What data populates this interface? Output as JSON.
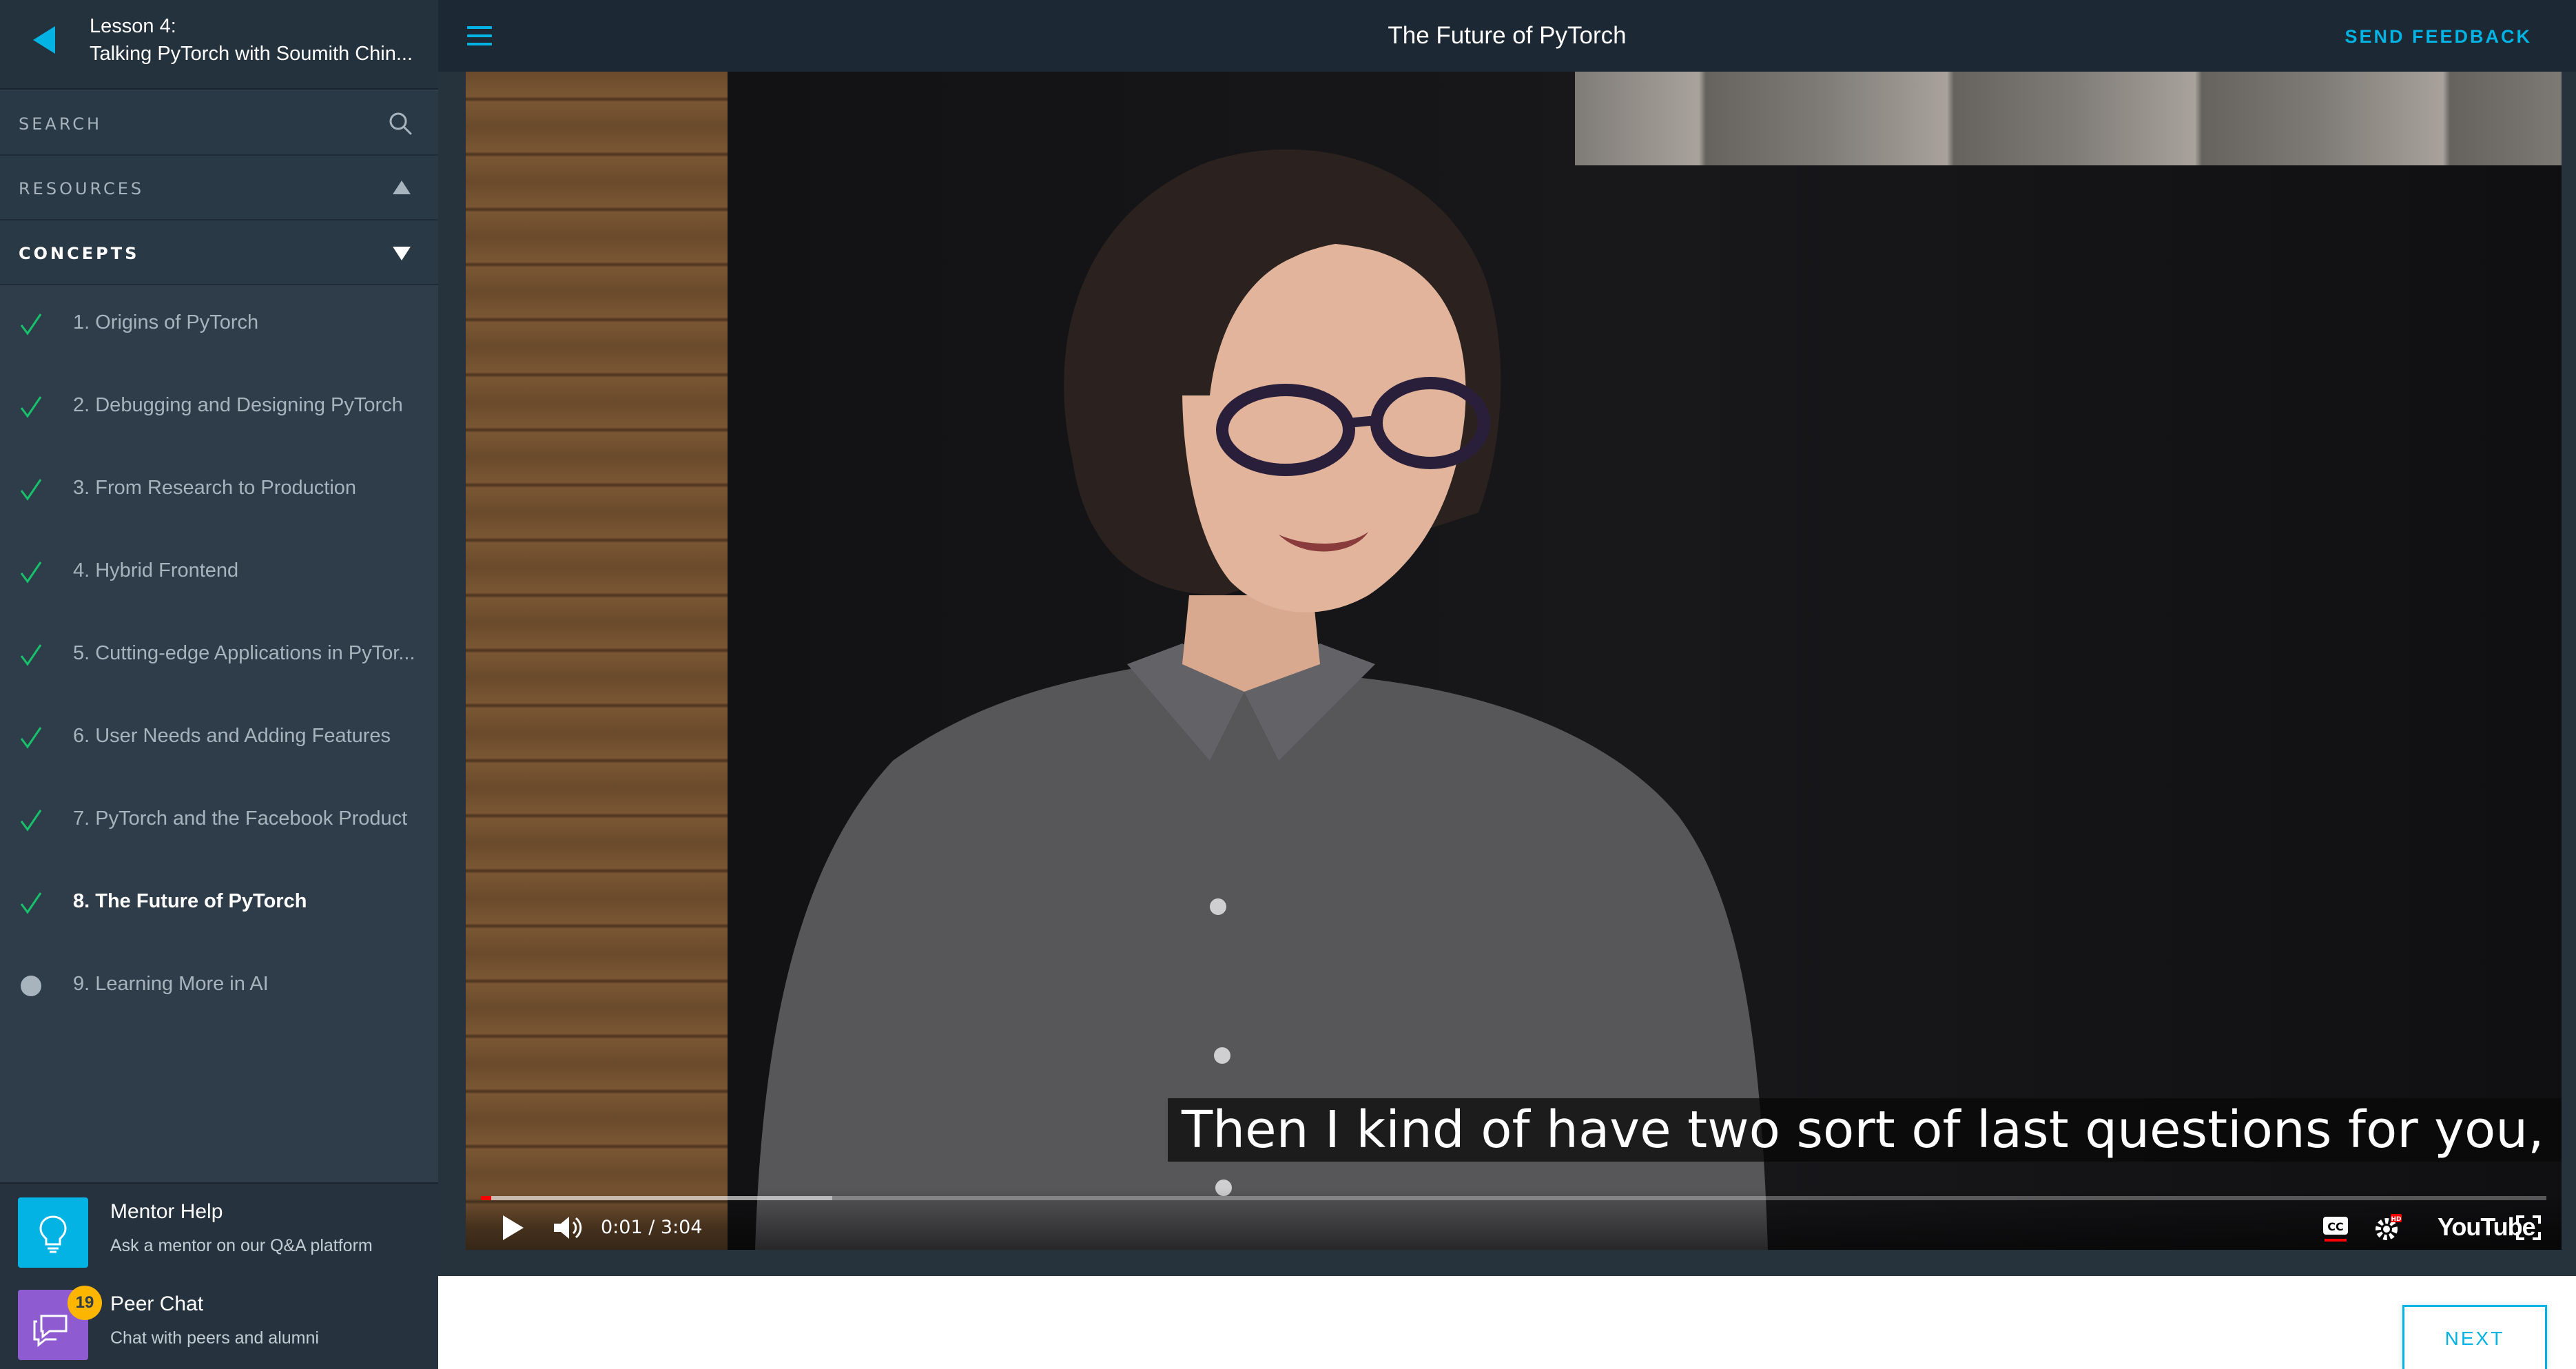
{
  "sidebar": {
    "lesson_number": "Lesson 4:",
    "lesson_title": "Talking PyTorch with Soumith Chin...",
    "search_label": "SEARCH",
    "resources_label": "RESOURCES",
    "concepts_label": "CONCEPTS",
    "concepts": [
      {
        "label": "1. Origins of PyTorch",
        "status": "complete"
      },
      {
        "label": "2. Debugging and Designing PyTorch",
        "status": "complete"
      },
      {
        "label": "3. From Research to Production",
        "status": "complete"
      },
      {
        "label": "4. Hybrid Frontend",
        "status": "complete"
      },
      {
        "label": "5. Cutting-edge Applications in PyTor...",
        "status": "complete"
      },
      {
        "label": "6. User Needs and Adding Features",
        "status": "complete"
      },
      {
        "label": "7. PyTorch and the Facebook Product",
        "status": "complete"
      },
      {
        "label": "8. The Future of PyTorch",
        "status": "complete-active"
      },
      {
        "label": "9. Learning More in AI",
        "status": "incomplete"
      }
    ],
    "mentor_help": {
      "title": "Mentor Help",
      "subtitle": "Ask a mentor on our Q&A platform"
    },
    "peer_chat": {
      "title": "Peer Chat",
      "subtitle": "Chat with peers and alumni",
      "badge": "19"
    }
  },
  "topbar": {
    "title": "The Future of PyTorch",
    "send_feedback": "SEND FEEDBACK"
  },
  "video": {
    "caption": "Then I kind of have two sort of last questions for you, like big picture.",
    "time": "0:01 / 3:04",
    "played_fraction": 0.005,
    "buffered_fraction": 0.17,
    "logo_text": "YouTube"
  },
  "footer": {
    "next_label": "NEXT"
  },
  "colors": {
    "accent": "#02b3e4",
    "sidebar_bg": "#2e3d49",
    "check": "#15c26b",
    "peer_chat": "#8f5bd1",
    "badge": "#fdb600"
  }
}
